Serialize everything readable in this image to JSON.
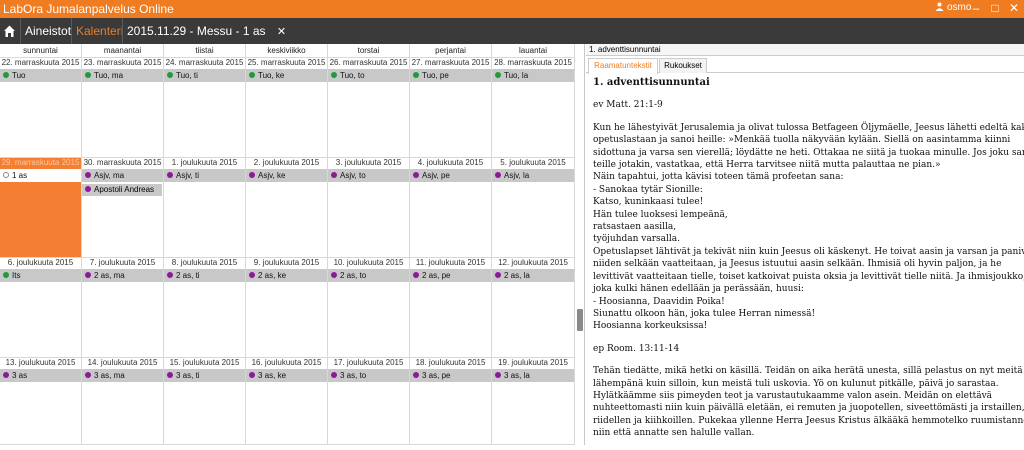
{
  "app": {
    "title": "LabOra Jumalanpalvelus Online",
    "user": "osmo"
  },
  "window_controls": {
    "minimize": "–",
    "maximize": "□",
    "close": "✕"
  },
  "nav": {
    "items": [
      {
        "label": "Aineistot"
      },
      {
        "label": "Kalenteri"
      },
      {
        "label": "2015.11.29 - Messu - 1 as"
      }
    ]
  },
  "calendar": {
    "days": [
      "sunnuntai",
      "maanantai",
      "tiistai",
      "keskiviikko",
      "torstai",
      "perjantai",
      "lauantai"
    ],
    "weeks": [
      {
        "dates": [
          "22. marraskuuta 2015",
          "23. marraskuuta 2015",
          "24. marraskuuta 2015",
          "25. marraskuuta 2015",
          "26. marraskuuta 2015",
          "27. marraskuuta 2015",
          "28. marraskuuta 2015"
        ],
        "events": [
          "Tuo",
          "Tuo, ma",
          "Tuo, ti",
          "Tuo, ke",
          "Tuo, to",
          "Tuo, pe",
          "Tuo, la"
        ],
        "extra": [
          "",
          "",
          "",
          "",
          "",
          "",
          ""
        ]
      },
      {
        "dates": [
          "29. marraskuuta 2015",
          "30. marraskuuta 2015",
          "1. joulukuuta 2015",
          "2. joulukuuta 2015",
          "3. joulukuuta 2015",
          "4. joulukuuta 2015",
          "5. joulukuuta 2015"
        ],
        "events": [
          "1 as",
          "Asjv, ma",
          "Asjv, ti",
          "Asjv, ke",
          "Asjv, to",
          "Asjv, pe",
          "Asjv, la"
        ],
        "extra": [
          "",
          "Apostoli Andreas",
          "",
          "",
          "",
          "",
          ""
        ]
      },
      {
        "dates": [
          "6. joulukuuta 2015",
          "7. joulukuuta 2015",
          "8. joulukuuta 2015",
          "9. joulukuuta 2015",
          "10. joulukuuta 2015",
          "11. joulukuuta 2015",
          "12. joulukuuta 2015"
        ],
        "events": [
          "Its",
          "2 as, ma",
          "2 as, ti",
          "2 as, ke",
          "2 as, to",
          "2 as, pe",
          "2 as, la"
        ],
        "extra": [
          "",
          "",
          "",
          "",
          "",
          "",
          ""
        ]
      },
      {
        "dates": [
          "13. joulukuuta 2015",
          "14. joulukuuta 2015",
          "15. joulukuuta 2015",
          "16. joulukuuta 2015",
          "17. joulukuuta 2015",
          "18. joulukuuta 2015",
          "19. joulukuuta 2015"
        ],
        "events": [
          "3 as",
          "3 as, ma",
          "3 as, ti",
          "3 as, ke",
          "3 as, to",
          "3 as, pe",
          "3 as, la"
        ],
        "extra": [
          "",
          "",
          "",
          "",
          "",
          "",
          ""
        ]
      }
    ]
  },
  "pane": {
    "title": "1. adventtisunnuntai",
    "tabs": [
      {
        "label": "Raamatuntekstit"
      },
      {
        "label": "Rukoukset"
      }
    ],
    "heading": "1. adventtisunnuntai",
    "ref1": "ev Matt. 21:1-9",
    "text1": [
      "Kun he lähestyivät Jerusalemia ja olivat tulossa Betfageen Öljymäelle, Jeesus lähetti edeltä kaksi",
      "opetuslastaan ja sanoi heille: »Menkää tuolla näkyvään kylään. Siellä on aasintamma kiinni",
      "sidottuna ja varsa sen vierellä; löydätte ne heti. Ottakaa ne siitä ja tuokaa minulle. Jos joku sanoo",
      "teille jotakin, vastatkaa, että Herra tarvitsee niitä mutta palauttaa ne pian.»",
      "Näin tapahtui, jotta kävisi toteen tämä profeetan sana:",
      "- Sanokaa tytär Sionille:",
      "Katso, kuninkaasi tulee!",
      "Hän tulee luoksesi lempeänä,",
      "ratsastaen aasilla,",
      "työjuhdan varsalla.",
      "Opetuslapset lähtivät ja tekivät niin kuin Jeesus oli käskenyt. He toivat aasin ja varsan ja panivat",
      "niiden selkään vaatteitaan, ja Jeesus istuutui aasin selkään. Ihmisiä oli hyvin paljon, ja he",
      "levittivät vaatteitaan tielle, toiset katkoivat puista oksia ja levittivät tielle niitä. Ja ihmisjoukko,",
      "joka kulki hänen edellään ja perässään, huusi:",
      "- Hoosianna, Daavidin Poika!",
      "Siunattu olkoon hän, joka tulee Herran nimessä!",
      "Hoosianna korkeuksissa!"
    ],
    "ref2": "ep Room. 13:11-14",
    "text2": [
      "Tehän tiedätte, mikä hetki on käsillä. Teidän on aika herätä unesta, sillä pelastus on nyt meitä",
      "lähempänä kuin silloin, kun meistä tuli uskovia. Yö on kulunut pitkälle, päivä jo sarastaa.",
      "Hylätkäämme siis pimeyden teot ja varustautukaamme valon asein. Meidän on elettävä",
      "nuhteettomasti niin kuin päivällä eletään, ei remuten ja juopotellen, siveettömästi ja irstaillen,",
      "riidellen ja kiihkoillen. Pukekaa yllenne Herra Jeesus Kristus älkääkä hemmotelko ruumistanne,",
      "niin että annatte sen halulle vallan."
    ]
  },
  "colors": {
    "accent": "#f07c22",
    "nav_bg": "#3a3a3a",
    "event_bg": "#c8c8c8",
    "dot_green": "#1f9a3c",
    "dot_purple": "#8c1a96"
  }
}
